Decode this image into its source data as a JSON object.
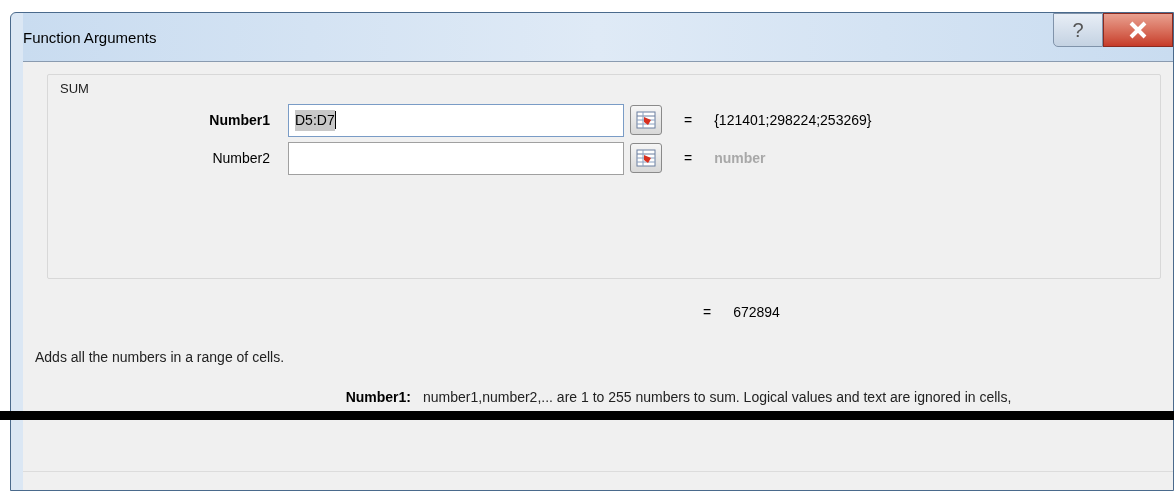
{
  "window": {
    "title": "Function Arguments"
  },
  "title_buttons": [
    {
      "kind": "help",
      "label": "?"
    },
    {
      "kind": "close"
    }
  ],
  "group": {
    "title": "SUM",
    "arguments": [
      {
        "label": "Number1",
        "bold": true,
        "value": "D5:D7",
        "selected": true,
        "equals": "=",
        "result": "{121401;298224;253269}",
        "result_placeholder": false
      },
      {
        "label": "Number2",
        "bold": false,
        "selected": false,
        "equals": "=",
        "result": "number",
        "result_placeholder": true
      }
    ]
  },
  "formula_result": {
    "equals": "=",
    "value": "672894"
  },
  "description": "Adds all the numbers in a range of cells.",
  "argument_help": {
    "label": "Number1:",
    "text": "number1,number2,... are 1 to 255 numbers to sum. Logical values and text are ignored in cells,"
  }
}
